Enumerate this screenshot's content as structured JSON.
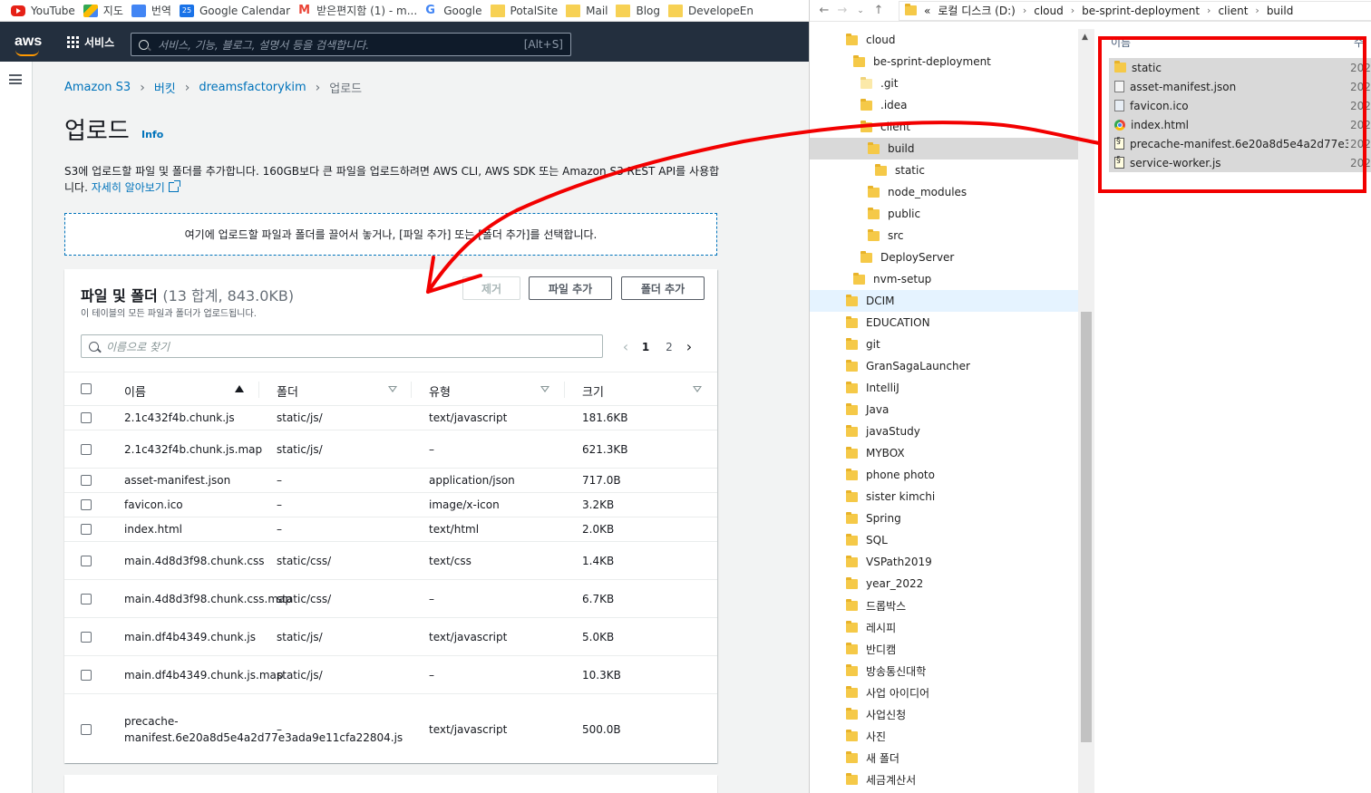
{
  "bookmarks": [
    {
      "label": "YouTube",
      "icon": "youtube-icon"
    },
    {
      "label": "지도",
      "icon": "maps-icon"
    },
    {
      "label": "번역",
      "icon": "translate-icon"
    },
    {
      "label": "Google Calendar",
      "icon": "calendar-icon",
      "badge": "25"
    },
    {
      "label": "받은편지함 (1) - m...",
      "icon": "gmail-icon"
    },
    {
      "label": "Google",
      "icon": "google-icon"
    },
    {
      "label": "PotalSite",
      "icon": "folder-icon"
    },
    {
      "label": "Mail",
      "icon": "folder-icon"
    },
    {
      "label": "Blog",
      "icon": "folder-icon"
    },
    {
      "label": "DevelopeEn",
      "icon": "folder-icon"
    }
  ],
  "aws": {
    "logo": "aws",
    "services_label": "서비스",
    "search_placeholder": "서비스, 기능, 블로그, 설명서 등을 검색합니다.",
    "search_shortcut": "[Alt+S]",
    "accent_color": "#ff9900",
    "nav_bg": "#232f3e"
  },
  "breadcrumb": {
    "items": [
      "Amazon S3",
      "버킷",
      "dreamsfactorykim"
    ],
    "current": "업로드"
  },
  "page": {
    "title": "업로드",
    "info": "Info",
    "description": "S3에 업로드할 파일 및 폴더를 추가합니다. 160GB보다 큰 파일을 업로드하려면 AWS CLI, AWS SDK 또는 Amazon S3 REST API를 사용합니다.",
    "learn_more": "자세히 알아보기",
    "dropzone_text": "여기에 업로드할 파일과 폴더를 끌어서 놓거나, [파일 추가] 또는 [폴더 추가]를 선택합니다."
  },
  "files_panel": {
    "title": "파일 및 폴더",
    "count": "(13 합계, 843.0KB)",
    "subtitle": "이 테이블의 모든 파일과 폴더가 업로드됩니다.",
    "remove_label": "제거",
    "add_files_label": "파일 추가",
    "add_folder_label": "폴더 추가",
    "filter_placeholder": "이름으로 찾기",
    "pages": [
      "1",
      "2"
    ],
    "current_page": "1",
    "columns": [
      "이름",
      "폴더",
      "유형",
      "크기"
    ],
    "rows": [
      {
        "name": "2.1c432f4b.chunk.js",
        "folder": "static/js/",
        "type": "text/javascript",
        "size": "181.6KB"
      },
      {
        "name": "2.1c432f4b.chunk.js.map",
        "folder": "static/js/",
        "type": "–",
        "size": "621.3KB"
      },
      {
        "name": "asset-manifest.json",
        "folder": "–",
        "type": "application/json",
        "size": "717.0B"
      },
      {
        "name": "favicon.ico",
        "folder": "–",
        "type": "image/x-icon",
        "size": "3.2KB"
      },
      {
        "name": "index.html",
        "folder": "–",
        "type": "text/html",
        "size": "2.0KB"
      },
      {
        "name": "main.4d8d3f98.chunk.css",
        "folder": "static/css/",
        "type": "text/css",
        "size": "1.4KB"
      },
      {
        "name": "main.4d8d3f98.chunk.css.map",
        "folder": "static/css/",
        "type": "–",
        "size": "6.7KB"
      },
      {
        "name": "main.df4b4349.chunk.js",
        "folder": "static/js/",
        "type": "text/javascript",
        "size": "5.0KB"
      },
      {
        "name": "main.df4b4349.chunk.js.map",
        "folder": "static/js/",
        "type": "–",
        "size": "10.3KB"
      },
      {
        "name": "precache-manifest.6e20a8d5e4a2d77e3ada9e11cfa22804.js",
        "folder": "–",
        "type": "text/javascript",
        "size": "500.0B"
      }
    ]
  },
  "explorer": {
    "path": [
      "«",
      "로컬 디스크 (D:)",
      "cloud",
      "be-sprint-deployment",
      "client",
      "build"
    ],
    "tree": [
      {
        "label": "cloud",
        "indent": 0
      },
      {
        "label": "be-sprint-deployment",
        "indent": 1
      },
      {
        "label": ".git",
        "indent": 2,
        "light": true
      },
      {
        "label": ".idea",
        "indent": 2
      },
      {
        "label": "client",
        "indent": 2
      },
      {
        "label": "build",
        "indent": 3,
        "selected": true
      },
      {
        "label": "static",
        "indent": 4
      },
      {
        "label": "node_modules",
        "indent": 3
      },
      {
        "label": "public",
        "indent": 3
      },
      {
        "label": "src",
        "indent": 3
      },
      {
        "label": "DeployServer",
        "indent": 2
      },
      {
        "label": "nvm-setup",
        "indent": 1
      },
      {
        "label": "DCIM",
        "indent": 0,
        "highlight": true
      },
      {
        "label": "EDUCATION",
        "indent": 0
      },
      {
        "label": "git",
        "indent": 0
      },
      {
        "label": "GranSagaLauncher",
        "indent": 0
      },
      {
        "label": "IntelliJ",
        "indent": 0
      },
      {
        "label": "Java",
        "indent": 0
      },
      {
        "label": "javaStudy",
        "indent": 0
      },
      {
        "label": "MYBOX",
        "indent": 0
      },
      {
        "label": "phone photo",
        "indent": 0
      },
      {
        "label": "sister kimchi",
        "indent": 0
      },
      {
        "label": "Spring",
        "indent": 0
      },
      {
        "label": "SQL",
        "indent": 0
      },
      {
        "label": "VSPath2019",
        "indent": 0
      },
      {
        "label": "year_2022",
        "indent": 0
      },
      {
        "label": "드롭박스",
        "indent": 0
      },
      {
        "label": "레시피",
        "indent": 0
      },
      {
        "label": "반디캠",
        "indent": 0
      },
      {
        "label": "방송통신대학",
        "indent": 0
      },
      {
        "label": "사업 아이디어",
        "indent": 0
      },
      {
        "label": "사업신청",
        "indent": 0
      },
      {
        "label": "사진",
        "indent": 0
      },
      {
        "label": "새 폴더",
        "indent": 0
      },
      {
        "label": "세금계산서",
        "indent": 0
      }
    ],
    "list_header_name": "이름",
    "list_header_date": "수",
    "files": [
      {
        "name": "static",
        "icon": "folder-icon",
        "date": "202"
      },
      {
        "name": "asset-manifest.json",
        "icon": "json-file-icon",
        "date": "202"
      },
      {
        "name": "favicon.ico",
        "icon": "ico-file-icon",
        "date": "202"
      },
      {
        "name": "index.html",
        "icon": "chrome-icon",
        "date": "202"
      },
      {
        "name": "precache-manifest.6e20a8d5e4a2d77e3...",
        "icon": "js-file-icon",
        "date": "202"
      },
      {
        "name": "service-worker.js",
        "icon": "js-file-icon",
        "date": "202"
      }
    ]
  },
  "annotation_color": "#f20000"
}
